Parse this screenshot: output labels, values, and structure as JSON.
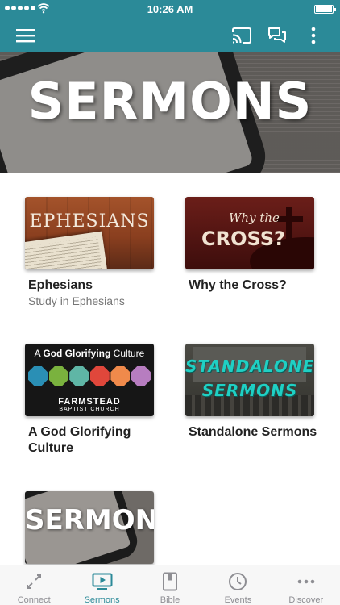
{
  "status_bar": {
    "time": "10:26 AM"
  },
  "header": {
    "menu_icon": "hamburger-menu-icon",
    "cast_icon": "cast-icon",
    "chat_icon": "chat-bubbles-icon",
    "more_icon": "more-vertical-icon"
  },
  "hero": {
    "title": "SERMONS"
  },
  "series": [
    {
      "title": "Ephesians",
      "subtitle": "Study in Ephesians",
      "thumb_text": "EPHESIANS"
    },
    {
      "title": "Why the Cross?",
      "subtitle": "",
      "thumb_line1": "Why the",
      "thumb_line2": "CROSS?"
    },
    {
      "title": "A God Glorifying Culture",
      "subtitle": "",
      "thumb_line1_pre": "A ",
      "thumb_line1_bold": "God Glorifying",
      "thumb_line1_post": " Culture",
      "church_name": "FARMSTEAD",
      "church_sub": "BAPTIST CHURCH"
    },
    {
      "title": "Standalone Sermons",
      "subtitle": "",
      "thumb_line1": "STANDALONE",
      "thumb_line2": "SERMONS"
    },
    {
      "title": "",
      "subtitle": "",
      "thumb_text": "SERMONS"
    }
  ],
  "tabs": [
    {
      "label": "Connect",
      "icon": "connect-arrows-icon",
      "active": false
    },
    {
      "label": "Sermons",
      "icon": "video-play-icon",
      "active": true
    },
    {
      "label": "Bible",
      "icon": "bible-book-icon",
      "active": false
    },
    {
      "label": "Events",
      "icon": "clock-icon",
      "active": false
    },
    {
      "label": "Discover",
      "icon": "more-horizontal-icon",
      "active": false
    }
  ],
  "colors": {
    "primary": "#2b8a98",
    "tab_inactive": "#8e8e93"
  }
}
